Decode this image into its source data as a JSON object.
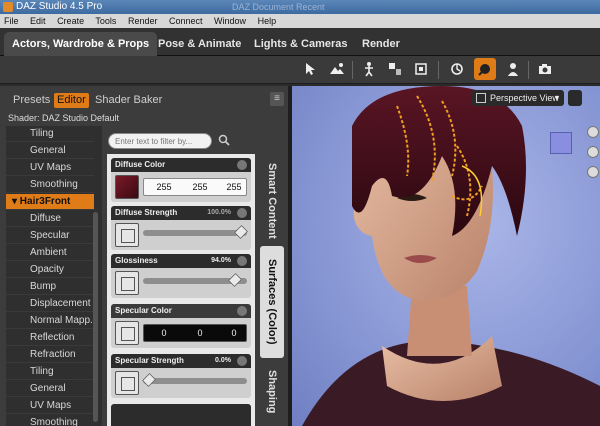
{
  "window": {
    "title": "DAZ Studio 4.5 Pro",
    "ghost_title": "DAZ Document Recent"
  },
  "menu": [
    "File",
    "Edit",
    "Create",
    "Tools",
    "Render",
    "Connect",
    "Window",
    "Help"
  ],
  "main_tabs": [
    "Actors, Wardrobe & Props",
    "Pose & Animate",
    "Lights & Cameras",
    "Render"
  ],
  "toolbar_icons": [
    "node-selection-icon",
    "scene-tool-icon",
    "joint-editor-icon",
    "region-navigator-icon",
    "tool-settings-icon",
    "surface-selection-icon",
    "geometry-editor-icon",
    "universal-tool-icon",
    "render-icon"
  ],
  "colors": {
    "accent": "#e07c17",
    "viewport_bg": "#8a99d6",
    "diffuse": "#5a0f1a"
  },
  "surfaces_pane": {
    "tabs": [
      "Presets",
      "Editor",
      "Shader Baker"
    ],
    "active_tab": "Editor",
    "shader_label": "Shader: DAZ Studio Default",
    "filter_placeholder": "Enter text to filter by...",
    "tree_items": [
      "Tiling",
      "General",
      "UV Maps",
      "Smoothing",
      "▾ Hair3Front",
      "Diffuse",
      "Specular",
      "Ambient",
      "Opacity",
      "Bump",
      "Displacement",
      "Normal Mapp...",
      "Reflection",
      "Refraction",
      "Tiling",
      "General",
      "UV Maps",
      "Smoothing"
    ],
    "properties": {
      "diffuse_color": {
        "label": "Diffuse Color",
        "r": "255",
        "g": "255",
        "b": "255"
      },
      "diffuse_strength": {
        "label": "Diffuse Strength",
        "value": "100.0%",
        "fraction": 1.0
      },
      "glossiness": {
        "label": "Glossiness",
        "value": "94.0%",
        "fraction": 0.94
      },
      "specular_color": {
        "label": "Specular Color",
        "r": "0",
        "g": "0",
        "b": "0"
      },
      "specular_strength": {
        "label": "Specular Strength",
        "value": "0.0%",
        "fraction": 0.0
      }
    },
    "side_tabs": [
      "Smart Content",
      "Surfaces (Color)",
      "Shaping"
    ]
  },
  "viewport": {
    "camera_label": "Perspective View"
  }
}
